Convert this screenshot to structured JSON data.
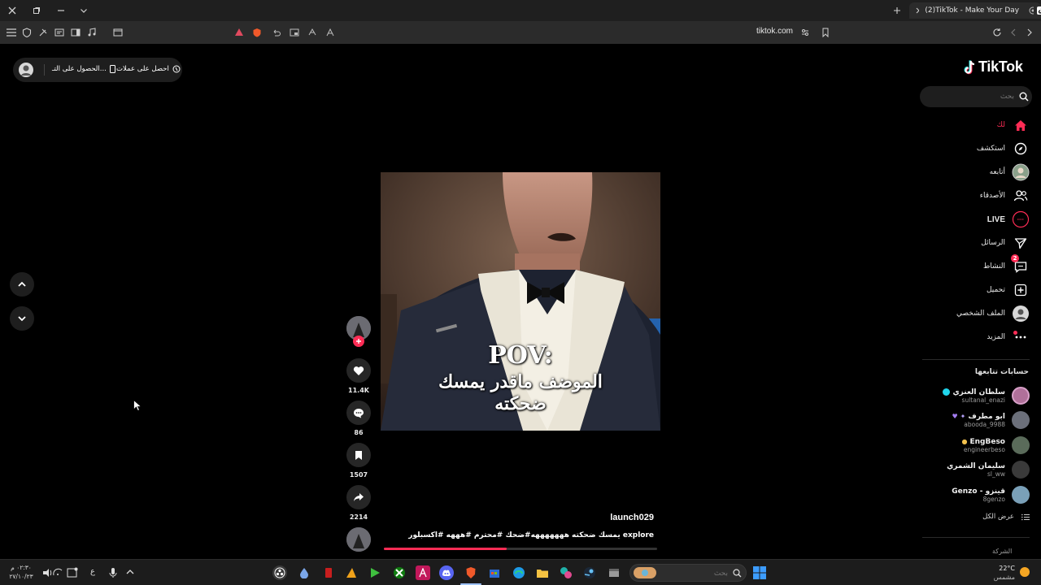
{
  "browser": {
    "tab_title": "(2)TikTok - Make Your Day",
    "url": "tiktok.com"
  },
  "promo": {
    "get_coins": "احصل على عملات",
    "get_app": "الحصول على التـ..."
  },
  "video": {
    "pov_text": "POV:",
    "caption_line1": "الموضف ماقدر يمسك",
    "caption_line2": "ضحكته",
    "author": "launch029",
    "description": "يمسك ضحكته هههههههه#ضحك #محترم #هههه #اكسبلور explore"
  },
  "actions": {
    "likes": "11.4K",
    "comments": "86",
    "saves": "1507",
    "shares": "2214"
  },
  "sidebar": {
    "logo": "TikTok",
    "search_placeholder": "بحث",
    "nav": [
      {
        "label": "لك",
        "icon": "home-icon"
      },
      {
        "label": "استكشف",
        "icon": "compass-icon"
      },
      {
        "label": "أتابعه",
        "icon": "following-avatar-icon"
      },
      {
        "label": "الأصدقاء",
        "icon": "friends-icon"
      },
      {
        "label": "LIVE",
        "icon": "live-icon"
      },
      {
        "label": "الرسائل",
        "icon": "messages-icon"
      },
      {
        "label": "النشاط",
        "icon": "activity-icon"
      },
      {
        "label": "تحميل",
        "icon": "upload-icon"
      },
      {
        "label": "الملف الشخصي",
        "icon": "profile-icon"
      },
      {
        "label": "المزيد",
        "icon": "more-icon"
      }
    ],
    "activity_badge": "2",
    "following_title": "حسابات تتابعها",
    "accounts": [
      {
        "name": "سلطان العنزي",
        "username": "sultanal_enazi",
        "color": "#b0709a"
      },
      {
        "name": "ابو مطرف",
        "username": "abooda_9988",
        "color": "#6b6f7a"
      },
      {
        "name": "EngBeso",
        "username": "engineerbeso",
        "color": "#5a6b5a"
      },
      {
        "name": "سليمان الشمري",
        "username": "sl_ww",
        "color": "#3a3a3a"
      },
      {
        "name": "Genzo - قينزو",
        "username": "8genzo",
        "color": "#7aa0b8"
      }
    ],
    "see_all": "عرض الكل",
    "company": "الشركة"
  },
  "taskbar": {
    "time": "٠٢:٣٠ م",
    "date": "٢٧/١٠/٢٣",
    "lang": "ع",
    "search_placeholder": "بحث",
    "weather_temp": "22°C",
    "weather_desc": "مشمس"
  },
  "colors": {
    "accent": "#fe2c55",
    "background": "#000000",
    "panel": "#1e1e1e"
  }
}
